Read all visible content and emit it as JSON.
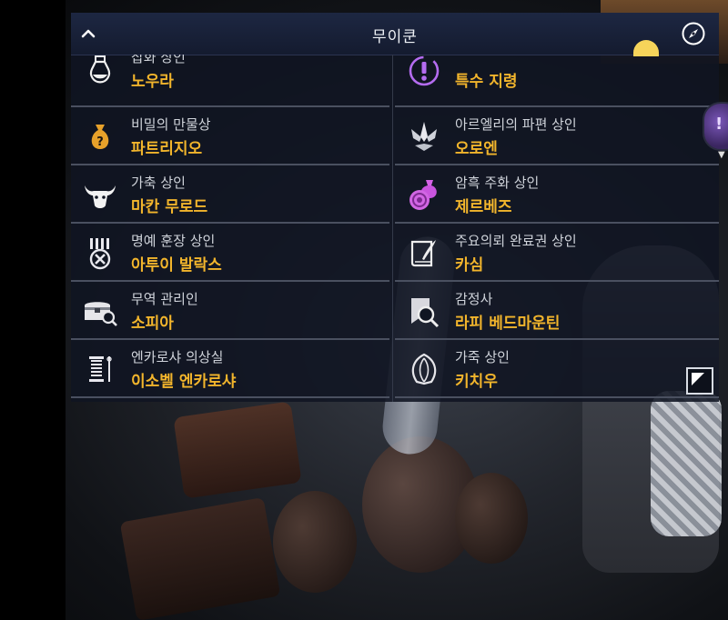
{
  "header": {
    "title": "무이쿤"
  },
  "npcs": [
    {
      "role": "잡화 상인",
      "name": "노우라",
      "icon": "potion-flask-icon"
    },
    {
      "role": "",
      "name": "특수 지령",
      "icon": "special-order-exclamation-icon"
    },
    {
      "role": "비밀의 만물상",
      "name": "파트리지오",
      "icon": "money-bag-question-icon"
    },
    {
      "role": "아르엘리의 파편 상인",
      "name": "오로엔",
      "icon": "shard-crystal-icon"
    },
    {
      "role": "가축 상인",
      "name": "마칸 무로드",
      "icon": "ox-head-icon"
    },
    {
      "role": "암흑 주화 상인",
      "name": "제르베즈",
      "icon": "dark-coin-pouch-icon"
    },
    {
      "role": "명예 훈장 상인",
      "name": "아투이 발락스",
      "icon": "honor-medal-icon"
    },
    {
      "role": "주요의뢰 완료권 상인",
      "name": "카심",
      "icon": "quest-book-quill-icon"
    },
    {
      "role": "무역 관리인",
      "name": "소피아",
      "icon": "trade-chest-search-icon"
    },
    {
      "role": "감정사",
      "name": "라피 베드마운틴",
      "icon": "appraiser-magnifier-icon"
    },
    {
      "role": "엔카로샤 의상실",
      "name": "이소벨 엔카로샤",
      "icon": "tailor-spool-needle-icon"
    },
    {
      "role": "가죽 상인",
      "name": "키치우",
      "icon": "leather-hide-icon"
    }
  ],
  "colors": {
    "name_text": "#f2b52c",
    "role_text": "#cfd3da",
    "panel_bg": "#101522",
    "header_bg": "#1d2742",
    "special_icon": "#b46cf0"
  }
}
